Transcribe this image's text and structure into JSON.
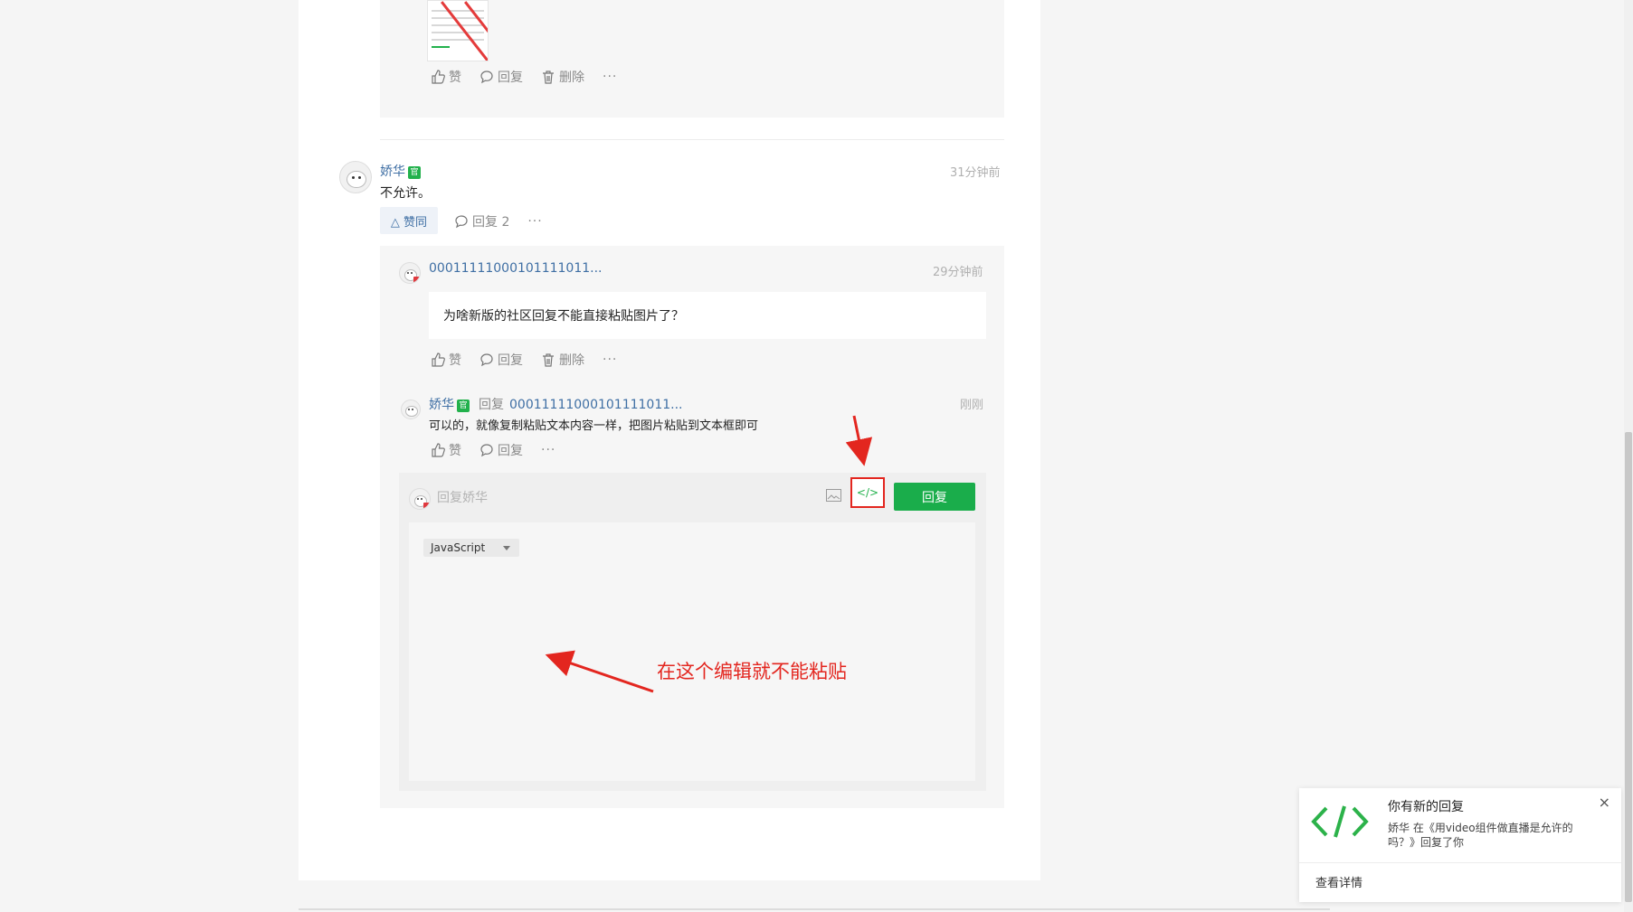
{
  "first_comment": {
    "actions": {
      "like": "赞",
      "reply": "回复",
      "delete": "删除",
      "more": "···"
    }
  },
  "comment": {
    "author": "娇华",
    "official_badge": "官",
    "time": "31分钟前",
    "text": "不允许。",
    "like_label": "△ 赞同",
    "reply_label": "回复 2",
    "more": "···"
  },
  "replies": [
    {
      "author": "00011111000101111011...",
      "time": "29分钟前",
      "text": "为啥新版的社区回复不能直接粘贴图片了？",
      "actions": {
        "like": "赞",
        "reply": "回复",
        "delete": "删除",
        "more": "···"
      }
    },
    {
      "author": "娇华",
      "official_badge": "官",
      "reply_to_label": "回复",
      "reply_target": "00011111000101111011...",
      "time": "刚刚",
      "text": "可以的，就像复制粘贴文本内容一样，把图片粘贴到文本框即可",
      "actions": {
        "like": "赞",
        "reply": "回复",
        "more": "···"
      }
    }
  ],
  "editor": {
    "placeholder": "回复娇华",
    "code_button": "</>",
    "submit_label": "回复",
    "language": "JavaScript"
  },
  "annotation": "在这个编辑就不能粘贴",
  "notification": {
    "title": "你有新的回复",
    "body": "娇华 在《用video组件做直播是允许的吗？》回复了你",
    "link": "查看详情",
    "close": "×"
  },
  "colors": {
    "accent_green": "#1aad4b",
    "link_blue": "#3f6fa4",
    "annotation_red": "#e3261f"
  }
}
